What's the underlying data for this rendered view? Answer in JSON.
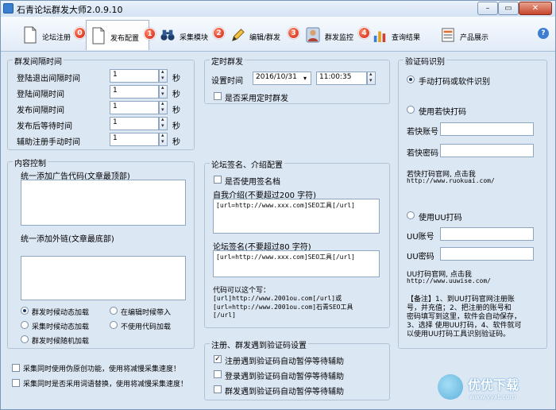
{
  "window": {
    "title": "石青论坛群发大师2.0.9.10",
    "min": "–",
    "max": "▭",
    "close": "✕"
  },
  "tabs": [
    {
      "label": "论坛注册",
      "badge": "0"
    },
    {
      "label": "发布配置",
      "badge": "1"
    },
    {
      "label": "采集模块",
      "badge": "2"
    },
    {
      "label": "编辑/群发",
      "badge": "3"
    },
    {
      "label": "群发监控",
      "badge": "4"
    },
    {
      "label": "查询结果"
    },
    {
      "label": "产品展示"
    }
  ],
  "help": "?",
  "interval": {
    "title": "群发间隔时间",
    "unit": "秒",
    "rows": [
      {
        "label": "登陆退出间隔时间",
        "value": "1"
      },
      {
        "label": "登陆间隔时间",
        "value": "1"
      },
      {
        "label": "发布间隔时间",
        "value": "1"
      },
      {
        "label": "发布后等待时间",
        "value": "1"
      },
      {
        "label": "辅助注册手动时间",
        "value": "1"
      }
    ]
  },
  "schedule": {
    "title": "定时群发",
    "time_label": "设置时间",
    "date": "2016/10/31",
    "time": "11:00:35",
    "enable_label": "是否采用定时群发"
  },
  "content": {
    "title": "内容控制",
    "ad_label": "统一添加广告代码(文章最顶部)",
    "link_label": "统一添加外链(文章最底部)",
    "radios": [
      {
        "label": "群发时候动态加载",
        "checked": true
      },
      {
        "label": "在编辑时候带入",
        "checked": false
      },
      {
        "label": "采集时候动态加载",
        "checked": false
      },
      {
        "label": "不使用代码加载",
        "checked": false
      },
      {
        "label": "群发时候随机加载",
        "checked": false
      }
    ]
  },
  "options": {
    "pseudo_original": "采集同时使用伪原创功能，使用将减慢采集速度！",
    "synonym": "采集同时是否采用词语替换，使用将减慢采集速度！"
  },
  "signature": {
    "title": "论坛签名、介绍配置",
    "use_sig": "是否使用签名档",
    "intro_label": "自我介绍(不要超过200 字符)",
    "intro_value": "[url=http://www.xxx.com]SEO工具[/url]",
    "sig_label": "论坛签名(不要超过80 字符)",
    "sig_value": "[url=http://www.xxx.com]SEO工具[/url]",
    "code_hint": [
      "代码可以这个写：",
      "[url]http://www.2001ou.com[/url]或",
      "[url=http://www.2001ou.com]石青SEO工具",
      "[/url]"
    ]
  },
  "captcha_pause": {
    "title": "注册、群发遇到验证码设置",
    "items": [
      {
        "label": "注册遇到验证码自动暂停等待辅助",
        "checked": true
      },
      {
        "label": "登录遇到验证码自动暂停等待辅助",
        "checked": false
      },
      {
        "label": "群发遇到验证码自动暂停等待辅助",
        "checked": false
      }
    ]
  },
  "captcha": {
    "title": "验证码识别",
    "manual": "手动打码或软件识别",
    "ruokuai": "使用若快打码",
    "rk_account": "若快账号",
    "rk_password": "若快密码",
    "rk_site": "若快打码官网, 点击我",
    "rk_url": "http://www.ruokuai.com/",
    "uu": "使用UU打码",
    "uu_account": "UU账号",
    "uu_password": "UU密码",
    "uu_site": "UU打码官网, 点击我",
    "uu_url": "http://www.uuwise.com/",
    "note": [
      "【备注】1、到UU打码官网注册账",
      "号，并充值；2、把注册的账号和",
      "密码填写到这里，软件会自动保存，",
      "3、选择 使用UU打码，4、软件就可",
      "以使用UU打码工具识别验证码。"
    ]
  },
  "watermark": {
    "text": "优优下载",
    "url": "www.yyxt.com"
  },
  "colors": {
    "badge": "#d01c0c",
    "accent": "#3d7ed3"
  }
}
